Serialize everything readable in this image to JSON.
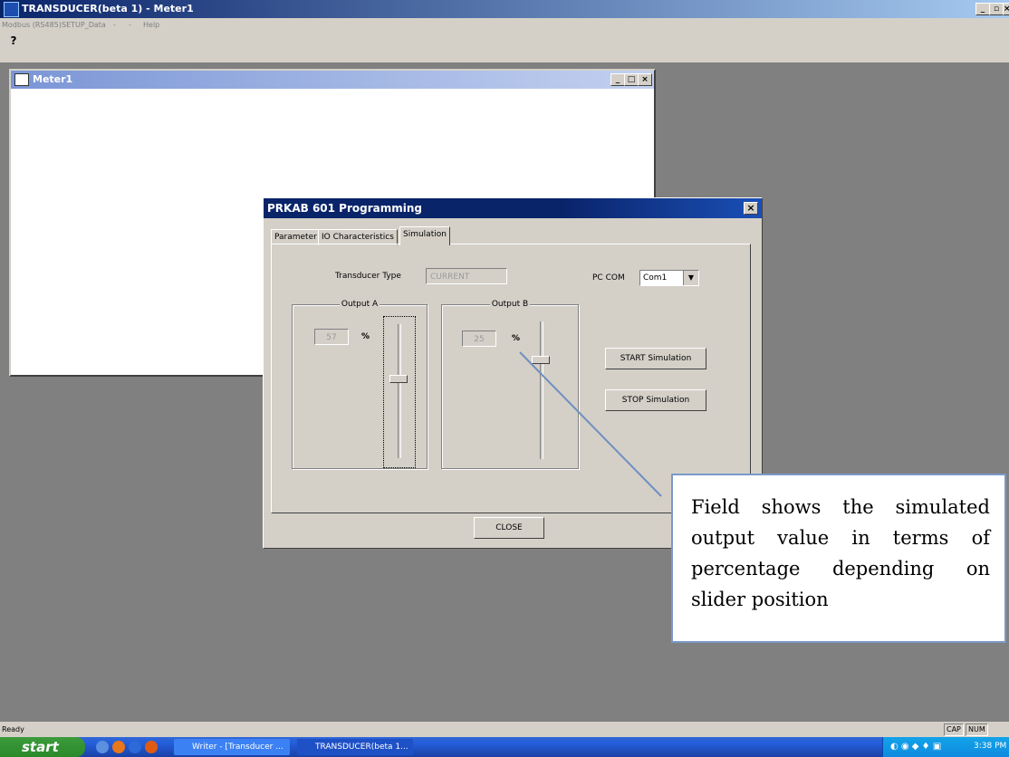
{
  "app": {
    "title": "TRANSDUCER(beta 1) - Meter1",
    "menu": [
      "Modbus (RS485)",
      "SETUP_Data",
      "-",
      "-",
      "Help"
    ],
    "toolbar_help": "?"
  },
  "child": {
    "title": "Meter1"
  },
  "dialog": {
    "title": "PRKAB 601 Programming",
    "close": "×",
    "tabs": [
      "Parameter",
      "IO Characteristics",
      "Simulation"
    ],
    "transducer_type_label": "Transducer Type",
    "transducer_type_value": "CURRENT",
    "pc_com_label": "PC COM",
    "pc_com_value": "Com1",
    "output_a": {
      "label": "Output A",
      "value": "57",
      "unit": "%",
      "slider_percent": 57
    },
    "output_b": {
      "label": "Output B",
      "value": "25",
      "unit": "%",
      "slider_percent": 25
    },
    "start_button": "START Simulation",
    "stop_button": "STOP Simulation",
    "close_button": "CLOSE"
  },
  "callout": {
    "text": "Field shows the simulated output value in terms of percentage depending on slider position"
  },
  "statusbar": {
    "text": "Ready",
    "cap": "CAP",
    "num": "NUM"
  },
  "taskbar": {
    "start": "start",
    "tasks": [
      "Writer - [Transducer ...",
      "TRANSDUCER(beta 1..."
    ],
    "clock": "3:38 PM"
  }
}
